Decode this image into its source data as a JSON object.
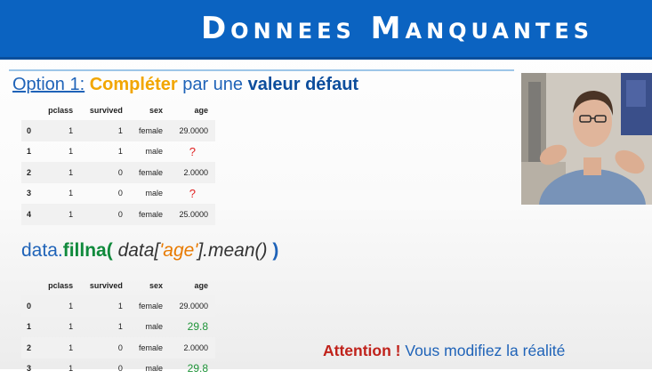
{
  "header": {
    "title": "Donnees Manquantes"
  },
  "option": {
    "label": "Option 1:",
    "word1": "Compléter",
    "word2": "par une",
    "word3": "valeur défaut"
  },
  "table1": {
    "headers": [
      "",
      "pclass",
      "survived",
      "sex",
      "age"
    ],
    "rows": [
      [
        "0",
        "1",
        "1",
        "female",
        "29.0000"
      ],
      [
        "1",
        "1",
        "1",
        "male",
        "?"
      ],
      [
        "2",
        "1",
        "0",
        "female",
        "2.0000"
      ],
      [
        "3",
        "1",
        "0",
        "male",
        "?"
      ],
      [
        "4",
        "1",
        "0",
        "female",
        "25.0000"
      ]
    ]
  },
  "code": {
    "obj": "data.",
    "fn": "fillna(",
    "arg_a": "data[",
    "arg_str": "'age'",
    "arg_b": "].mean()",
    "close": ")"
  },
  "table2": {
    "headers": [
      "",
      "pclass",
      "survived",
      "sex",
      "age"
    ],
    "rows": [
      [
        "0",
        "1",
        "1",
        "female",
        "29.0000"
      ],
      [
        "1",
        "1",
        "1",
        "male",
        "29.8"
      ],
      [
        "2",
        "1",
        "0",
        "female",
        "2.0000"
      ],
      [
        "3",
        "1",
        "0",
        "male",
        "29.8"
      ]
    ]
  },
  "warning": {
    "strong": "Attention !",
    "text": "Vous modifiez la réalité"
  },
  "colors": {
    "banner": "#0b63c1",
    "accent_orange": "#f2a600",
    "missing_red": "#e02020",
    "filled_green": "#1e9438"
  }
}
